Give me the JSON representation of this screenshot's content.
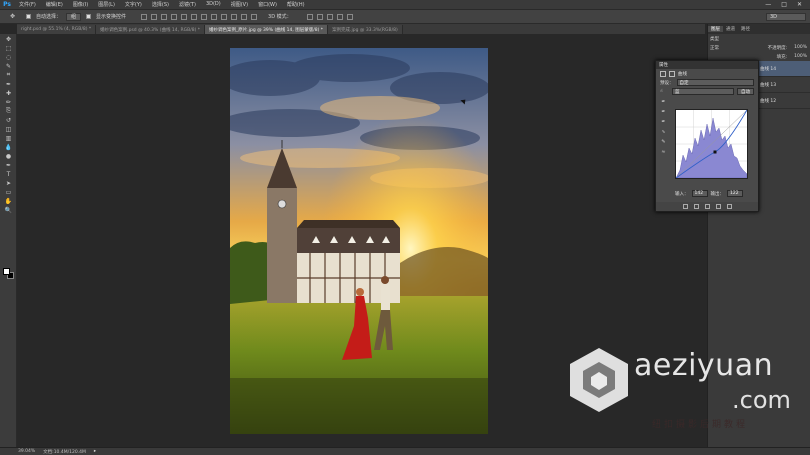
{
  "app": {
    "logo": "Ps"
  },
  "menu": [
    "文件(F)",
    "编辑(E)",
    "图像(I)",
    "图层(L)",
    "文字(Y)",
    "选择(S)",
    "滤镜(T)",
    "3D(D)",
    "视图(V)",
    "窗口(W)",
    "帮助(H)"
  ],
  "window_controls": [
    "—",
    "□",
    "✕"
  ],
  "options": {
    "auto_select_label": "自动选择：",
    "auto_select_value": "组",
    "show_transform_label": "显示变换控件",
    "mode3d_label": "3D 模式：",
    "workspace": "3D"
  },
  "tabs": [
    {
      "label": "right.psd @ 55.1% (4, RGB/8) *",
      "active": false
    },
    {
      "label": "婚纱调色案例.psd @ 40.3% (曲线 14, RGB/8) *",
      "active": false
    },
    {
      "label": "婚纱调色案例_原片.jpg @ 39% (曲线 14, 图层蒙版/8) *",
      "active": true
    },
    {
      "label": "案例完成.jpg @ 33.3%(RGB/8)",
      "active": false
    }
  ],
  "tools": [
    "move-tool",
    "marquee-tool",
    "lasso-tool",
    "quick-select-tool",
    "crop-tool",
    "eyedropper-tool",
    "healing-tool",
    "brush-tool",
    "clone-tool",
    "history-brush-tool",
    "eraser-tool",
    "gradient-tool",
    "blur-tool",
    "dodge-tool",
    "pen-tool",
    "type-tool",
    "path-select-tool",
    "shape-tool",
    "hand-tool",
    "zoom-tool"
  ],
  "tool_glyphs": [
    "✥",
    "⬚",
    "◌",
    "✎",
    "⌗",
    "✒",
    "✚",
    "✏",
    "⎘",
    "↺",
    "◫",
    "▥",
    "💧",
    "●",
    "✒",
    "T",
    "➤",
    "▭",
    "✋",
    "🔍"
  ],
  "panels": {
    "strip_tabs": [
      "图层",
      "通道",
      "路径"
    ],
    "layer_mode": "正常",
    "opacity_label": "不透明度:",
    "opacity_value": "100%",
    "fill_label": "填充:",
    "fill_value": "100%",
    "kind_label": "类型",
    "layers": [
      {
        "name": "曲线 14",
        "selected": true
      },
      {
        "name": "曲线 13",
        "selected": false
      },
      {
        "name": "曲线 12",
        "selected": false
      }
    ]
  },
  "properties": {
    "title": "属性",
    "header": "曲线",
    "preset_label": "预设：",
    "preset_value": "自定",
    "channel_value": "蓝",
    "auto_button": "自动",
    "input_label": "输入：",
    "input_value": "142",
    "output_label": "输出：",
    "output_value": "122"
  },
  "status": {
    "zoom": "39.04%",
    "doc_size": "文档:10.4M/120.4M"
  },
  "watermark": {
    "brand": "aeziyuan",
    "tld": ".com",
    "tagline": "纽扣摄影后期教程"
  }
}
